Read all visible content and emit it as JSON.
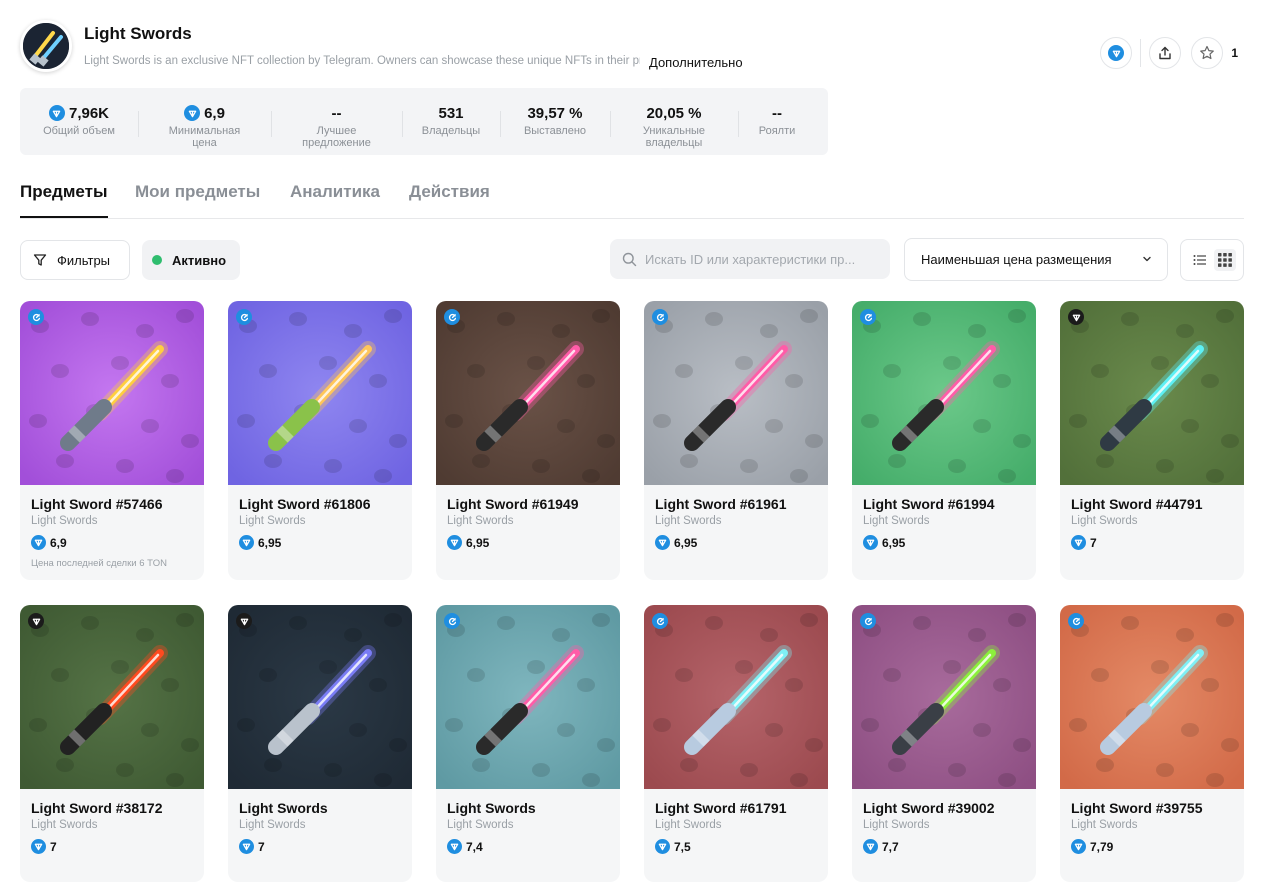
{
  "header": {
    "title": "Light Swords",
    "description": "Light Swords is an exclusive NFT collection by Telegram. Owners can showcase these unique NFTs in their profile",
    "more_label": "Дополнительно",
    "favorites_count": "1"
  },
  "stats": [
    {
      "value": "7,96K",
      "label": "Общий объем",
      "ton": true
    },
    {
      "value": "6,9",
      "label": "Минимальная цена",
      "ton": true
    },
    {
      "value": "--",
      "label": "Лучшее предложение",
      "ton": false
    },
    {
      "value": "531",
      "label": "Владельцы",
      "ton": false
    },
    {
      "value": "39,57 %",
      "label": "Выставлено",
      "ton": false
    },
    {
      "value": "20,05 %",
      "label": "Уникальные владельцы",
      "ton": false
    },
    {
      "value": "--",
      "label": "Роялти",
      "ton": false
    }
  ],
  "tabs": [
    "Предметы",
    "Мои предметы",
    "Аналитика",
    "Действия"
  ],
  "toolbar": {
    "filters_label": "Фильтры",
    "active_label": "Активно",
    "search_placeholder": "Искать ID или характеристики пр...",
    "sort_label": "Наименьшая цена размещения"
  },
  "items": [
    {
      "name": "Light Sword #57466",
      "collection": "Light Swords",
      "price": "6,9",
      "last_sale": "Цена последней сделки 6 TON",
      "badge": "blue",
      "bg": "#a24fd9",
      "bg2": "#c477f0",
      "blade": "#ffcf3f",
      "handle": "#6f7b8a"
    },
    {
      "name": "Light Sword #61806",
      "collection": "Light Swords",
      "price": "6,95",
      "last_sale": "",
      "badge": "blue",
      "bg": "#6f64e2",
      "bg2": "#8f86f0",
      "blade": "#ffc65a",
      "handle": "#8ac24a"
    },
    {
      "name": "Light Sword #61949",
      "collection": "Light Swords",
      "price": "6,95",
      "last_sale": "",
      "badge": "blue",
      "bg": "#4f3b32",
      "bg2": "#6a5247",
      "blade": "#ff5ca8",
      "handle": "#2a2a2a"
    },
    {
      "name": "Light Sword #61961",
      "collection": "Light Swords",
      "price": "6,95",
      "last_sale": "",
      "badge": "blue",
      "bg": "#9aa0a8",
      "bg2": "#b9bec5",
      "blade": "#ff5ca8",
      "handle": "#2a2a2a"
    },
    {
      "name": "Light Sword #61994",
      "collection": "Light Swords",
      "price": "6,95",
      "last_sale": "",
      "badge": "blue",
      "bg": "#45ad6a",
      "bg2": "#6cc98a",
      "blade": "#ff5ca8",
      "handle": "#2a2a2a"
    },
    {
      "name": "Light Sword #44791",
      "collection": "Light Swords",
      "price": "7",
      "last_sale": "",
      "badge": "dark",
      "bg": "#52703a",
      "bg2": "#6a8a4c",
      "blade": "#5ef0f5",
      "handle": "#2f3a44"
    },
    {
      "name": "Light Sword #38172",
      "collection": "Light Swords",
      "price": "7",
      "last_sale": "",
      "badge": "dark",
      "bg": "#3f5a33",
      "bg2": "#557346",
      "blade": "#ff4a1f",
      "handle": "#222"
    },
    {
      "name": "Light Swords",
      "collection": "Light Swords",
      "price": "7",
      "last_sale": "",
      "badge": "dark",
      "bg": "#1f2a35",
      "bg2": "#2b3946",
      "blade": "#7a7cf5",
      "handle": "#b9c2cc"
    },
    {
      "name": "Light Swords",
      "collection": "Light Swords",
      "price": "7,4",
      "last_sale": "",
      "badge": "blue",
      "bg": "#5f9aa3",
      "bg2": "#7fb6be",
      "blade": "#ff5ca8",
      "handle": "#2a2a2a"
    },
    {
      "name": "Light Sword #61791",
      "collection": "Light Swords",
      "price": "7,5",
      "last_sale": "",
      "badge": "blue",
      "bg": "#9c4a4f",
      "bg2": "#b5646a",
      "blade": "#7ff0f5",
      "handle": "#b8cbe0"
    },
    {
      "name": "Light Sword #39002",
      "collection": "Light Swords",
      "price": "7,7",
      "last_sale": "",
      "badge": "blue",
      "bg": "#8e4f83",
      "bg2": "#a86b9c",
      "blade": "#8cf03c",
      "handle": "#3a3f46"
    },
    {
      "name": "Light Sword #39755",
      "collection": "Light Swords",
      "price": "7,79",
      "last_sale": "",
      "badge": "blue",
      "bg": "#d26a48",
      "bg2": "#e48a66",
      "blade": "#7ff0f5",
      "handle": "#b8cbe0"
    }
  ]
}
